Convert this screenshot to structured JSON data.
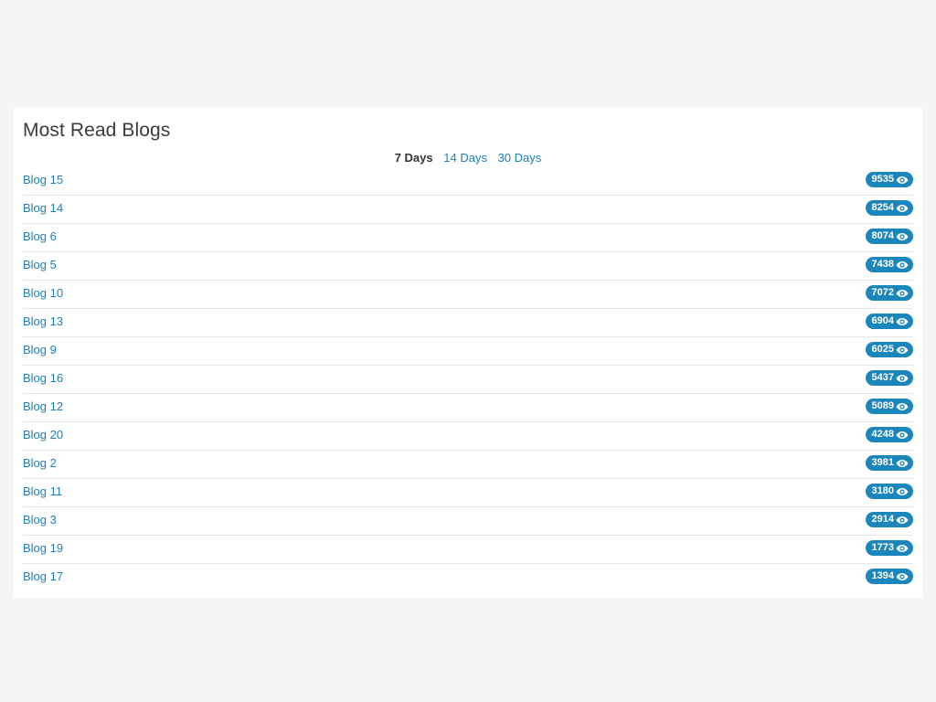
{
  "panel": {
    "title": "Most Read Blogs"
  },
  "range_tabs": [
    {
      "label": "7 Days",
      "active": true
    },
    {
      "label": "14 Days",
      "active": false
    },
    {
      "label": "30 Days",
      "active": false
    }
  ],
  "blogs": [
    {
      "title": "Blog 15",
      "views": "9535"
    },
    {
      "title": "Blog 14",
      "views": "8254"
    },
    {
      "title": "Blog 6",
      "views": "8074"
    },
    {
      "title": "Blog 5",
      "views": "7438"
    },
    {
      "title": "Blog 10",
      "views": "7072"
    },
    {
      "title": "Blog 13",
      "views": "6904"
    },
    {
      "title": "Blog 9",
      "views": "6025"
    },
    {
      "title": "Blog 16",
      "views": "5437"
    },
    {
      "title": "Blog 12",
      "views": "5089"
    },
    {
      "title": "Blog 20",
      "views": "4248"
    },
    {
      "title": "Blog 2",
      "views": "3981"
    },
    {
      "title": "Blog 11",
      "views": "3180"
    },
    {
      "title": "Blog 3",
      "views": "2914"
    },
    {
      "title": "Blog 19",
      "views": "1773"
    },
    {
      "title": "Blog 17",
      "views": "1394"
    }
  ],
  "icons": {
    "views": "eye-icon"
  },
  "colors": {
    "link": "#1d7fb8",
    "badge": "#1b86bb",
    "background": "#f5f5f5",
    "panel": "#ffffff"
  }
}
